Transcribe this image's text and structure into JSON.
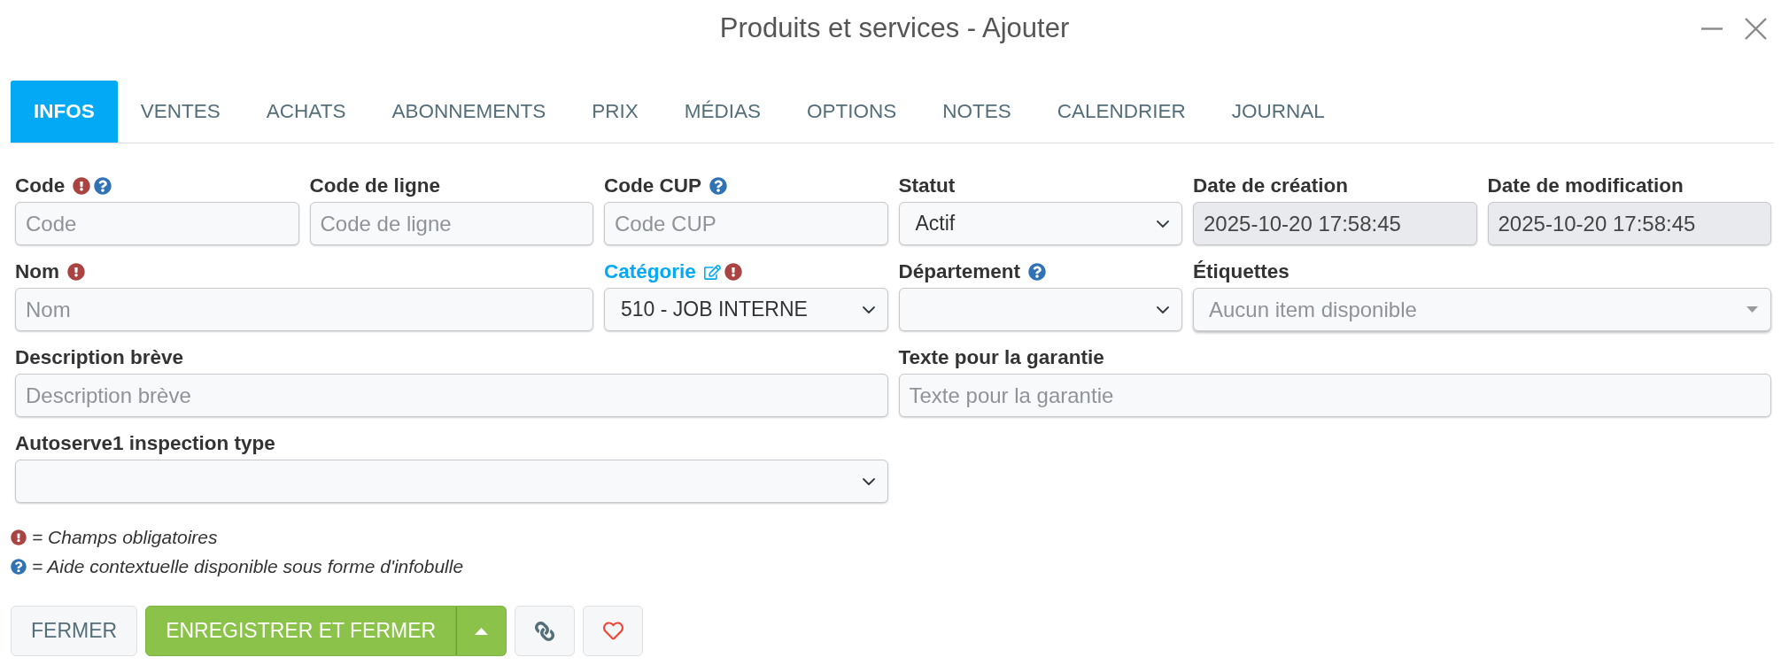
{
  "window": {
    "title": "Produits et services - Ajouter"
  },
  "tabs": [
    {
      "label": "INFOS",
      "selected": true
    },
    {
      "label": "VENTES",
      "selected": false
    },
    {
      "label": "ACHATS",
      "selected": false
    },
    {
      "label": "ABONNEMENTS",
      "selected": false
    },
    {
      "label": "PRIX",
      "selected": false
    },
    {
      "label": "MÉDIAS",
      "selected": false
    },
    {
      "label": "OPTIONS",
      "selected": false
    },
    {
      "label": "NOTES",
      "selected": false
    },
    {
      "label": "CALENDRIER",
      "selected": false
    },
    {
      "label": "JOURNAL",
      "selected": false
    }
  ],
  "fields": [
    {
      "kind": "text",
      "label": "Code",
      "required": true,
      "help": true,
      "editable": false,
      "disabled": false,
      "placeholder": "Code"
    },
    {
      "kind": "text",
      "label": "Code de ligne",
      "required": false,
      "help": false,
      "editable": false,
      "disabled": false,
      "placeholder": "Code de ligne"
    },
    {
      "kind": "text",
      "label": "Code CUP",
      "required": false,
      "help": true,
      "editable": false,
      "disabled": false,
      "placeholder": "Code CUP"
    },
    {
      "kind": "select",
      "label": "Statut",
      "required": false,
      "help": false,
      "editable": false,
      "disabled": false,
      "value": "Actif"
    },
    {
      "kind": "text",
      "label": "Date de création",
      "required": false,
      "help": false,
      "editable": false,
      "disabled": true,
      "value": "2025-10-20 17:58:45"
    },
    {
      "kind": "text",
      "label": "Date de modification",
      "required": false,
      "help": false,
      "editable": false,
      "disabled": true,
      "value": "2025-10-20 17:58:45"
    },
    {
      "kind": "text",
      "label": "Nom",
      "required": true,
      "help": false,
      "editable": false,
      "disabled": false,
      "placeholder": "Nom"
    },
    {
      "kind": "select",
      "label": "Catégorie",
      "required": true,
      "help": false,
      "editable": true,
      "disabled": false,
      "value": "510 - JOB INTERNE"
    },
    {
      "kind": "select",
      "label": "Département",
      "required": false,
      "help": true,
      "editable": false,
      "disabled": false
    },
    {
      "kind": "tags",
      "label": "Étiquettes",
      "required": false,
      "help": false,
      "editable": false,
      "disabled": false,
      "placeholder": "Aucun item disponible"
    },
    {
      "kind": "text",
      "label": "Description brève",
      "required": false,
      "help": false,
      "editable": false,
      "disabled": false,
      "placeholder": "Description brève"
    },
    {
      "kind": "text",
      "label": "Texte pour la garantie",
      "required": false,
      "help": false,
      "editable": false,
      "disabled": false,
      "placeholder": "Texte pour la garantie"
    },
    {
      "kind": "select",
      "label": "Autoserve1 inspection type",
      "required": false,
      "help": false,
      "editable": false,
      "disabled": false
    }
  ],
  "legend": [
    {
      "kind": "required",
      "text": "= Champs obligatoires"
    },
    {
      "kind": "help",
      "text": "= Aide contextuelle disponible sous forme d'infobulle"
    }
  ],
  "buttons": [
    {
      "kind": "default",
      "label": "FERMER"
    },
    {
      "kind": "primary",
      "label": "ENREGISTRER ET FERMER"
    }
  ]
}
